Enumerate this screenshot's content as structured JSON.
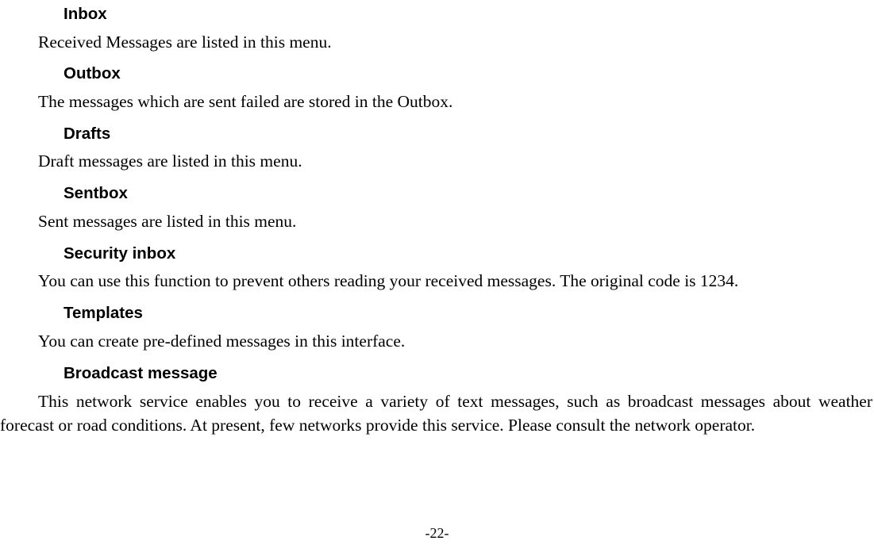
{
  "sections": [
    {
      "heading": "Inbox",
      "body": "Received Messages are listed in this menu."
    },
    {
      "heading": "Outbox",
      "body": "The messages which are sent failed are stored in the Outbox."
    },
    {
      "heading": "Drafts",
      "body": "Draft messages are listed in this menu."
    },
    {
      "heading": "Sentbox",
      "body": "Sent messages are listed in this menu."
    },
    {
      "heading": "Security inbox",
      "body": "You can use this function to prevent others reading your received messages. The original code is 1234."
    },
    {
      "heading": "Templates",
      "body": "You can create pre-defined messages in this interface."
    },
    {
      "heading": "Broadcast message",
      "body": "This network service enables you to receive a variety of text messages, such as broadcast messages about weather forecast or road conditions. At present, few networks provide this service. Please consult the network operator."
    }
  ],
  "page_number": "-22-"
}
